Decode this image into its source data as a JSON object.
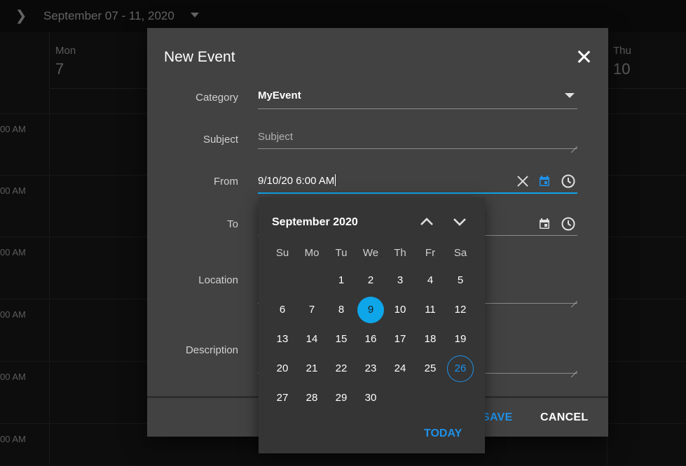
{
  "scheduler": {
    "date_range": "September 07 - 11, 2020",
    "days": [
      {
        "name": "Mon",
        "num": "7"
      },
      {
        "name": "Thu",
        "num": "10"
      }
    ],
    "time_labels": [
      "00 AM",
      "00 AM",
      "00 AM",
      "00 AM",
      "00 AM",
      "00 AM"
    ]
  },
  "dialog": {
    "title": "New Event",
    "fields": {
      "category": {
        "label": "Category",
        "value": "MyEvent"
      },
      "subject": {
        "label": "Subject",
        "placeholder": "Subject"
      },
      "from": {
        "label": "From",
        "value": "9/10/20 6:00 AM"
      },
      "to": {
        "label": "To"
      },
      "location": {
        "label": "Location"
      },
      "description": {
        "label": "Description"
      }
    },
    "buttons": {
      "save": "SAVE",
      "cancel": "CANCEL"
    }
  },
  "calendar": {
    "month_title": "September 2020",
    "weekdays": [
      "Su",
      "Mo",
      "Tu",
      "We",
      "Th",
      "Fr",
      "Sa"
    ],
    "weeks": [
      [
        "",
        "",
        "1",
        "2",
        "3",
        "4",
        "5"
      ],
      [
        "6",
        "7",
        "8",
        "9",
        "10",
        "11",
        "12"
      ],
      [
        "13",
        "14",
        "15",
        "16",
        "17",
        "18",
        "19"
      ],
      [
        "20",
        "21",
        "22",
        "23",
        "24",
        "25",
        "26"
      ],
      [
        "27",
        "28",
        "29",
        "30",
        "",
        "",
        ""
      ]
    ],
    "selected_day": "9",
    "today_day": "26",
    "today_label": "TODAY"
  },
  "colors": {
    "accent": "#0ea5e9",
    "link": "#1e90e8",
    "dialog_bg": "#424242",
    "popup_bg": "#353535"
  }
}
